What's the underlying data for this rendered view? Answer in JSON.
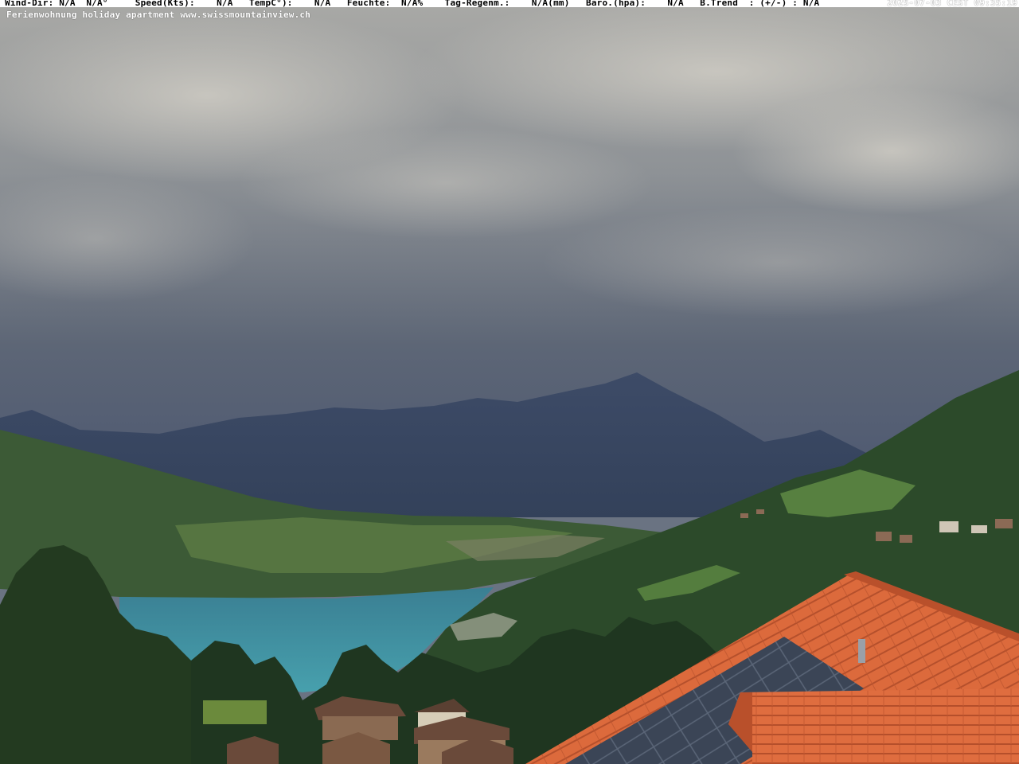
{
  "overlay": {
    "weather_line": "Wind-Dir: N/A  N/A°     Speed(Kts):    N/A   TempC°):    N/A   Feuchte:  N/A%    Tag-Regenm.:    N/A(mm)   Baro.(hpa):    N/A   B.Trend  : (+/-) : N/A",
    "timestamp": "2025-07-03 CEST 09:35:19",
    "website": "Ferienwohnung holiday apartment www.swissmountainview.ch"
  },
  "colors": {
    "sky": "#6e7685",
    "clouds": "#b9b7b0",
    "mountain": "#3c4b66",
    "lake": "#3d8a9a",
    "forest": "#2a4a2a",
    "roof_tiles": "#d9643a",
    "solar_panel": "#3c4658"
  }
}
